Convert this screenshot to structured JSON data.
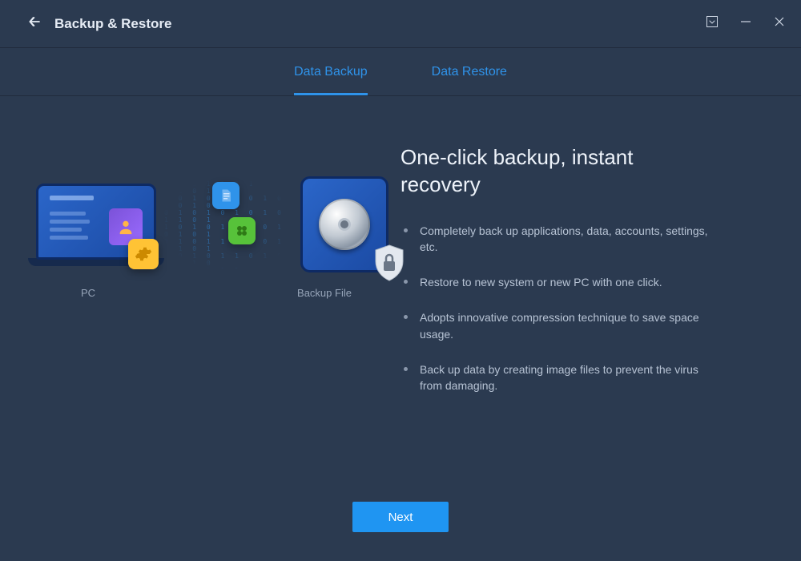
{
  "titlebar": {
    "title": "Backup & Restore"
  },
  "tabs": {
    "backup": "Data Backup",
    "restore": "Data Restore",
    "active": "backup"
  },
  "illustration": {
    "pc_label": "PC",
    "file_label": "Backup File"
  },
  "main": {
    "heading": "One-click backup, instant recovery",
    "features": [
      "Completely back up applications, data, accounts, settings, etc.",
      "Restore to new system or new PC with one click.",
      "Adopts innovative compression technique to save space usage.",
      "Back up data by creating image files to prevent the virus from damaging."
    ]
  },
  "footer": {
    "next": "Next"
  }
}
